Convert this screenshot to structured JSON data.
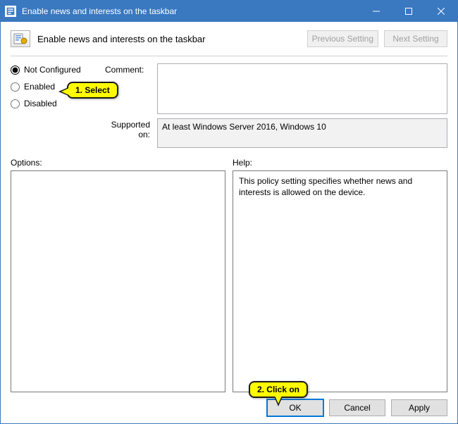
{
  "titlebar": {
    "title": "Enable news and interests on the taskbar"
  },
  "header": {
    "title": "Enable news and interests on the taskbar"
  },
  "nav": {
    "previous": "Previous Setting",
    "next": "Next Setting"
  },
  "radios": {
    "not_configured": "Not Configured",
    "enabled": "Enabled",
    "disabled": "Disabled",
    "selected": "not_configured"
  },
  "labels": {
    "comment": "Comment:",
    "supported": "Supported on:",
    "options": "Options:",
    "help": "Help:"
  },
  "comment_value": "",
  "supported_value": "At least Windows Server 2016, Windows 10",
  "options_value": "",
  "help_value": "This policy setting specifies whether news and interests is allowed on the device.",
  "buttons": {
    "ok": "OK",
    "cancel": "Cancel",
    "apply": "Apply"
  },
  "annotations": {
    "step1": "1. Select",
    "step2": "2. Click on"
  }
}
